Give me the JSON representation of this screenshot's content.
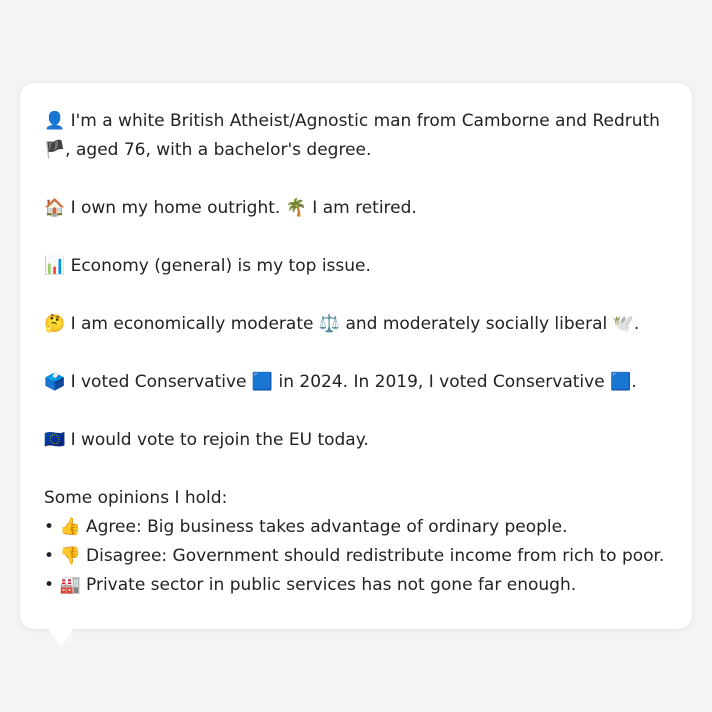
{
  "bubble": {
    "identity": {
      "icon": "👤",
      "text_1": " I'm a white British Atheist/Agnostic man from Camborne and Redruth ",
      "flag": "🏴",
      "text_2": ", aged 76, with a bachelor's degree."
    },
    "home": {
      "icon": "🏠",
      "text_1": " I own my home outright. ",
      "icon_2": "🌴",
      "text_2": " I am retired."
    },
    "issue": {
      "icon": "📊",
      "text": " Economy (general) is my top issue."
    },
    "politics": {
      "icon": "🤔",
      "text_1": " I am economically moderate ",
      "icon_2": "⚖️",
      "text_2": " and moderately socially liberal ",
      "icon_3": "🕊️",
      "text_3": "."
    },
    "vote": {
      "icon": "🗳️",
      "text_1": " I voted Conservative ",
      "icon_2": "🟦",
      "text_2": " in 2024. In 2019, I voted Conservative ",
      "icon_3": "🟦",
      "text_3": "."
    },
    "eu": {
      "icon": "🇪🇺",
      "text": " I would vote to rejoin the EU today."
    },
    "opinions_heading": "Some opinions I hold:",
    "opinions": [
      {
        "bullet": "• ",
        "icon": "👍",
        "text": " Agree: Big business takes advantage of ordinary people."
      },
      {
        "bullet": "• ",
        "icon": "👎",
        "text": " Disagree: Government should redistribute income from rich to poor."
      },
      {
        "bullet": "• ",
        "icon": "🏭",
        "text": " Private sector in public services has not gone far enough."
      }
    ]
  }
}
